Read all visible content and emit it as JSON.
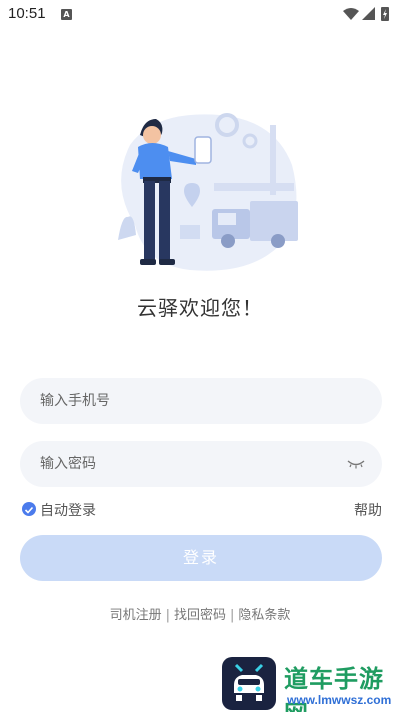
{
  "status_bar": {
    "time": "10:51",
    "notification_letter": "A",
    "icons": [
      "wifi-icon",
      "signal-icon",
      "battery-icon"
    ]
  },
  "welcome_text": "云驿欢迎您！",
  "phone_input": {
    "placeholder": "输入手机号",
    "value": ""
  },
  "password_input": {
    "placeholder": "输入密码",
    "value": ""
  },
  "auto_login": {
    "label": "自动登录",
    "checked": true
  },
  "help_label": "帮助",
  "login_button": {
    "label": "登录"
  },
  "footer_links": {
    "register": "司机注册",
    "forgot": "找回密码",
    "privacy": "隐私条款",
    "separator": "|"
  },
  "watermark": {
    "title": "道车手游网",
    "url": "www.lmwwsz.com"
  },
  "colors": {
    "accent": "#4b7bec",
    "button_disabled": "#c9daf7",
    "field_bg": "#f3f5f9",
    "watermark_green": "#1f9c61",
    "watermark_blue": "#2f6fd6"
  }
}
